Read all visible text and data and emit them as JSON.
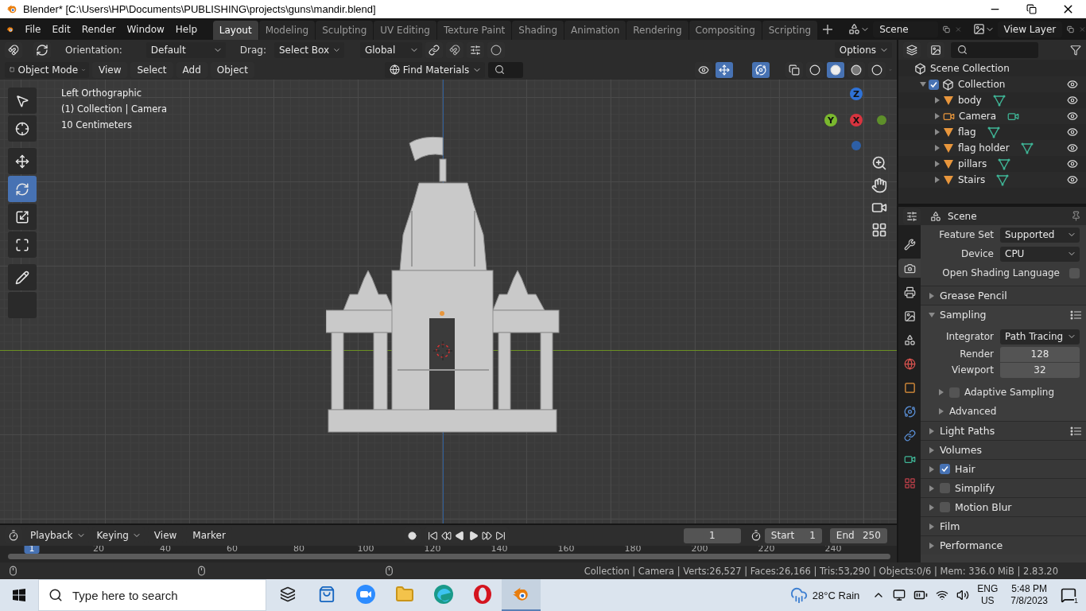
{
  "window": {
    "title": "Blender* [C:\\Users\\HP\\Documents\\PUBLISHING\\projects\\guns\\mandir.blend]"
  },
  "menu": [
    "File",
    "Edit",
    "Render",
    "Window",
    "Help"
  ],
  "workspaces": [
    {
      "label": "Layout",
      "selected": true
    },
    {
      "label": "Modeling",
      "selected": false
    },
    {
      "label": "Sculpting",
      "selected": false
    },
    {
      "label": "UV Editing",
      "selected": false
    },
    {
      "label": "Texture Paint",
      "selected": false
    },
    {
      "label": "Shading",
      "selected": false
    },
    {
      "label": "Animation",
      "selected": false
    },
    {
      "label": "Rendering",
      "selected": false
    },
    {
      "label": "Compositing",
      "selected": false
    },
    {
      "label": "Scripting",
      "selected": false
    }
  ],
  "scene": "Scene",
  "view_layer": "View Layer",
  "tool_settings": {
    "orientation_label": "Orientation:",
    "orientation": "Default",
    "drag_label": "Drag:",
    "drag": "Select Box",
    "transform": "Global",
    "options": "Options"
  },
  "viewport_header": {
    "mode": "Object Mode",
    "menus": [
      "View",
      "Select",
      "Add",
      "Object"
    ],
    "material_filter": "Find Materials",
    "shading": [
      {
        "kind": "wireframe",
        "selected": false
      },
      {
        "kind": "solid",
        "selected": true
      },
      {
        "kind": "material",
        "selected": false
      },
      {
        "kind": "rendered",
        "selected": false
      }
    ]
  },
  "viewport": {
    "overlay": [
      "Left Orthographic",
      "(1) Collection | Camera",
      "10 Centimeters"
    ],
    "tools": [
      {
        "kind": "select",
        "selected": false
      },
      {
        "kind": "cursor",
        "selected": false
      },
      {
        "kind": "move",
        "selected": false
      },
      {
        "kind": "rotate",
        "selected": true
      },
      {
        "kind": "scale",
        "selected": false
      },
      {
        "kind": "transform",
        "selected": false
      },
      {
        "kind": "annotate",
        "selected": false
      },
      {
        "kind": "measure",
        "selected": false
      }
    ],
    "axes": [
      {
        "label": "Z",
        "color": "#2f72d6"
      },
      {
        "label": "Y",
        "color": "#7ab82e"
      },
      {
        "label": "X",
        "color": "#d8343f"
      }
    ]
  },
  "outliner": {
    "items": [
      {
        "name": "Scene Collection",
        "kind": "scene_collection",
        "children": [
          {
            "name": "Collection",
            "kind": "collection",
            "checked": true,
            "expanded": true,
            "children": [
              {
                "name": "body",
                "kind": "mesh",
                "expanded": false
              },
              {
                "name": "Camera",
                "kind": "camera",
                "expanded": false
              },
              {
                "name": "flag",
                "kind": "mesh",
                "expanded": false
              },
              {
                "name": "flag holder",
                "kind": "mesh",
                "expanded": false
              },
              {
                "name": "pillars",
                "kind": "mesh",
                "expanded": false
              },
              {
                "name": "Stairs",
                "kind": "mesh",
                "expanded": false
              }
            ]
          }
        ]
      }
    ]
  },
  "properties": {
    "title": "Scene",
    "tabs": [
      {
        "kind": "tool",
        "selected": false
      },
      {
        "kind": "render",
        "selected": true
      },
      {
        "kind": "output",
        "selected": false
      },
      {
        "kind": "view_layer",
        "selected": false
      },
      {
        "kind": "scene",
        "selected": false
      },
      {
        "kind": "world",
        "selected": false
      },
      {
        "kind": "object",
        "selected": false
      },
      {
        "kind": "physics",
        "selected": false
      },
      {
        "kind": "constraints",
        "selected": false
      },
      {
        "kind": "camera_data",
        "selected": false
      },
      {
        "kind": "texture",
        "selected": false
      }
    ],
    "rows": [
      {
        "kind": "dropdown",
        "label": "Feature Set",
        "value": "Supported"
      },
      {
        "kind": "dropdown",
        "label": "Device",
        "value": "CPU"
      },
      {
        "kind": "checkbox",
        "label": "Open Shading Language",
        "checked": false
      }
    ],
    "panels": [
      {
        "label": "Grease Pencil",
        "expanded": false,
        "presets": false
      },
      {
        "label": "Sampling",
        "expanded": true,
        "presets": true,
        "rows": [
          {
            "kind": "dropdown",
            "label": "Integrator",
            "value": "Path Tracing"
          },
          {
            "kind": "number",
            "label": "Render",
            "value": "128"
          },
          {
            "kind": "number",
            "label": "Viewport",
            "value": "32"
          }
        ],
        "subpanels": [
          {
            "label": "Adaptive Sampling",
            "expanded": false,
            "checked": false
          },
          {
            "label": "Advanced",
            "expanded": false
          }
        ]
      },
      {
        "label": "Light Paths",
        "expanded": false,
        "presets": true
      },
      {
        "label": "Volumes",
        "expanded": false,
        "presets": false
      },
      {
        "label": "Hair",
        "expanded": false,
        "presets": false,
        "checked": true
      },
      {
        "label": "Simplify",
        "expanded": false,
        "presets": false,
        "checked": false
      },
      {
        "label": "Motion Blur",
        "expanded": false,
        "presets": false,
        "checked": false
      },
      {
        "label": "Film",
        "expanded": false,
        "presets": false
      },
      {
        "label": "Performance",
        "expanded": false,
        "presets": false
      }
    ]
  },
  "timeline": {
    "menus": [
      "Playback",
      "Keying",
      "View",
      "Marker"
    ],
    "current_frame": "1",
    "start_label": "Start",
    "start": "1",
    "end_label": "End",
    "end": "250",
    "ruler": [
      {
        "label": "1",
        "selected": true
      },
      {
        "label": "20",
        "selected": false
      },
      {
        "label": "40",
        "selected": false
      },
      {
        "label": "60",
        "selected": false
      },
      {
        "label": "80",
        "selected": false
      },
      {
        "label": "100",
        "selected": false
      },
      {
        "label": "120",
        "selected": false
      },
      {
        "label": "140",
        "selected": false
      },
      {
        "label": "160",
        "selected": false
      },
      {
        "label": "180",
        "selected": false
      },
      {
        "label": "200",
        "selected": false
      },
      {
        "label": "220",
        "selected": false
      },
      {
        "label": "240",
        "selected": false
      }
    ]
  },
  "status_bar": "Collection | Camera | Verts:26,527 | Faces:26,166 | Tris:53,290 | Objects:0/6 | Mem: 336.0 MiB | 2.83.20",
  "taskbar": {
    "search_placeholder": "Type here to search",
    "apps": [
      {
        "kind": "task_view",
        "selected": false
      },
      {
        "kind": "store",
        "selected": false
      },
      {
        "kind": "zoom",
        "selected": false
      },
      {
        "kind": "explorer",
        "selected": false
      },
      {
        "kind": "edge",
        "selected": false
      },
      {
        "kind": "opera",
        "selected": false
      },
      {
        "kind": "blender",
        "selected": true
      }
    ],
    "weather": "28°C  Rain",
    "language": "ENG",
    "region": "US",
    "time": "5:48 PM",
    "date": "7/8/2023",
    "notifications": "1"
  }
}
